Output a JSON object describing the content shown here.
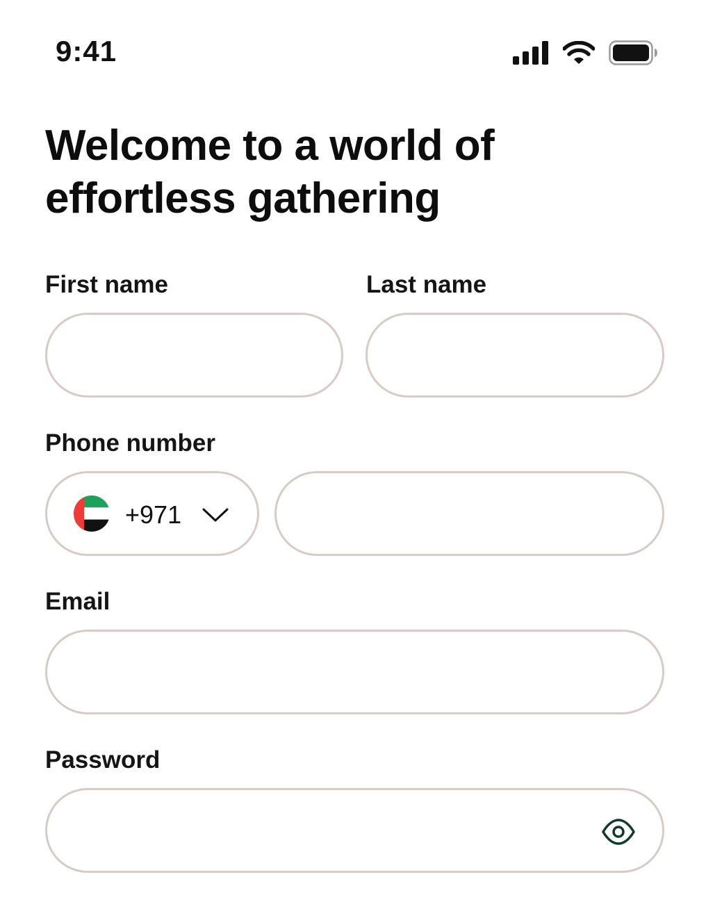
{
  "status_bar": {
    "time": "9:41",
    "icons": [
      "cellular-signal-icon",
      "wifi-icon",
      "battery-icon"
    ]
  },
  "header": {
    "title": "Welcome to a world of effortless gathering"
  },
  "form": {
    "first_name": {
      "label": "First name",
      "value": "",
      "placeholder": ""
    },
    "last_name": {
      "label": "Last name",
      "value": "",
      "placeholder": ""
    },
    "phone": {
      "label": "Phone number",
      "country_flag": "uae-flag-icon",
      "country_code": "+971",
      "value": "",
      "placeholder": ""
    },
    "email": {
      "label": "Email",
      "value": "",
      "placeholder": ""
    },
    "password": {
      "label": "Password",
      "value": "",
      "placeholder": "",
      "toggle_icon": "eye-icon"
    }
  },
  "colors": {
    "input_border": "#d8cbc5",
    "eye_icon": "#0f3b2a",
    "flag_red": "#ef3b36",
    "flag_green": "#1ea05a",
    "flag_black": "#111111"
  }
}
